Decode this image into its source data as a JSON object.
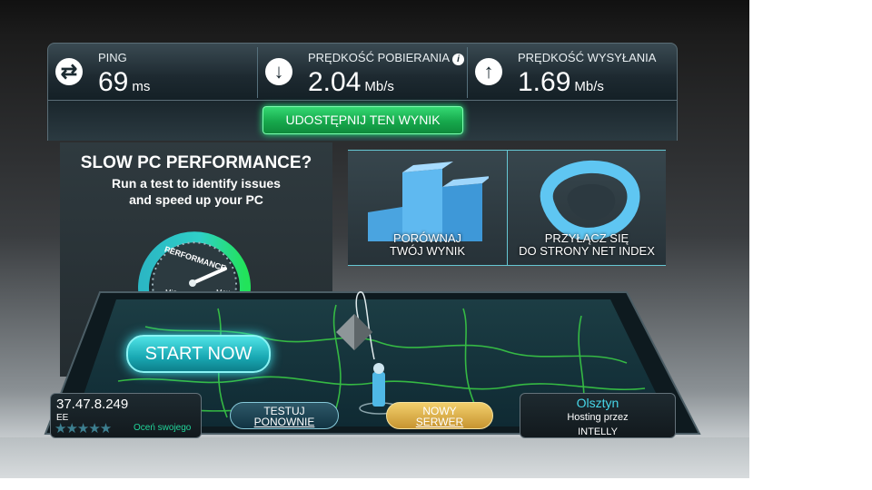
{
  "stats": {
    "ping": {
      "label": "PING",
      "value": "69",
      "unit": "ms",
      "icon": "swap-arrows-icon"
    },
    "download": {
      "label": "PRĘDKOŚĆ POBIERANIA",
      "value": "2.04",
      "unit": "Mb/s",
      "icon": "arrow-down-icon"
    },
    "upload": {
      "label": "PRĘDKOŚĆ WYSYŁANIA",
      "value": "1.69",
      "unit": "Mb/s",
      "icon": "arrow-up-icon"
    }
  },
  "share_button": "UDOSTĘPNIJ TEN WYNIK",
  "ad": {
    "title": "SLOW PC PERFORMANCE?",
    "line1": "Run a test to identify issues",
    "line2": "and speed up your PC",
    "gauge_label": "PERFORMANCE",
    "gauge_min": "Min",
    "gauge_max": "Max",
    "start_button": "START NOW"
  },
  "tiles": {
    "compare": {
      "line1": "PORÓWNAJ",
      "line2": "TWÓJ WYNIK"
    },
    "netindex": {
      "line1": "PRZYŁĄCZ SIĘ",
      "line2": "DO STRONY NET INDEX"
    }
  },
  "client": {
    "ip": "37.47.8.249",
    "isp": "EE",
    "rate_text": "Oceń swojego"
  },
  "buttons": {
    "retest": {
      "line1": "TESTUJ",
      "line2": "PONOWNIE"
    },
    "new_server": {
      "line1": "NOWY",
      "line2": "SERWER"
    }
  },
  "server": {
    "city": "Olsztyn",
    "hosting": "Hosting przez",
    "host_name": "INTELLY"
  },
  "colors": {
    "accent_green": "#16a84c",
    "accent_cyan": "#19a8b3",
    "gold": "#c79430"
  }
}
